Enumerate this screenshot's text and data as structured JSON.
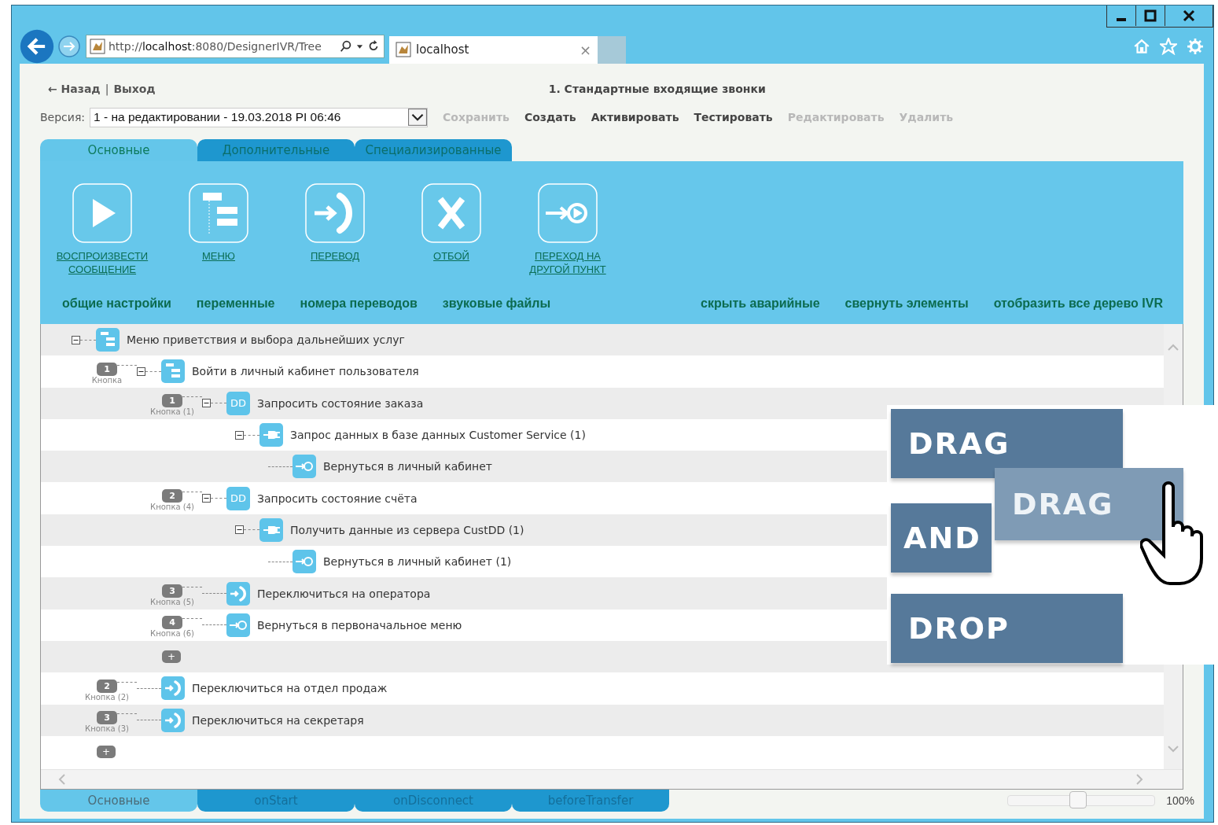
{
  "browser": {
    "url": "http://**localhost**:8080/DesignerIVR/Tree",
    "tab_title": "localhost",
    "tab_close": "×"
  },
  "nav": {
    "back": "← Назад",
    "separator": "|",
    "exit": "Выход"
  },
  "page_title": "1. Стандартные входящие звонки",
  "version": {
    "label": "Версия:",
    "value": "1 - на редактировании - 19.03.2018 PI 06:46"
  },
  "actions": [
    {
      "label": "Сохранить",
      "disabled": true
    },
    {
      "label": "Создать",
      "disabled": false
    },
    {
      "label": "Активировать",
      "disabled": false
    },
    {
      "label": "Тестировать",
      "disabled": false
    },
    {
      "label": "Редактировать",
      "disabled": true
    },
    {
      "label": "Удалить",
      "disabled": true
    }
  ],
  "tabs": [
    {
      "label": "Основные",
      "selected": true
    },
    {
      "label": "Дополнительные",
      "selected": false
    },
    {
      "label": "Специализированные",
      "selected": false
    }
  ],
  "tools": [
    {
      "kind": "play",
      "label": "ВОСПРОИЗВЕСТИ\nСООБЩЕНИЕ"
    },
    {
      "kind": "menu",
      "label": "МЕНЮ"
    },
    {
      "kind": "transfer",
      "label": "ПЕРЕВОД"
    },
    {
      "kind": "hangup",
      "label": "ОТБОЙ"
    },
    {
      "kind": "goto",
      "label": "ПЕРЕХОД НА\nДРУГОЙ ПУНКТ"
    }
  ],
  "links_left": [
    "общие настройки",
    "переменные",
    "номера переводов",
    "звуковые файлы"
  ],
  "links_right": [
    "скрыть аварийные",
    "свернуть элементы",
    "отобразить все дерево IVR"
  ],
  "tree": {
    "kind": "menu",
    "label": "Меню приветствия и выбора дальнейших услуг",
    "expanded": true,
    "children": [
      {
        "badge": "1",
        "caption": "Кнопка",
        "kind": "menu",
        "label": "Войти в личный кабинет пользователя",
        "expanded": true,
        "add": "+",
        "children": [
          {
            "badge": "1",
            "caption": "Кнопка (1)",
            "kind": "dd",
            "icon_text": "DD",
            "label": "Запросить состояние заказа",
            "expanded": true,
            "children": [
              {
                "kind": "plug",
                "label": "Запрос данных в базе данных Customer Service (1)",
                "expanded": true,
                "children": [
                  {
                    "kind": "goto",
                    "label": "Вернуться в личный кабинет"
                  }
                ]
              }
            ]
          },
          {
            "badge": "2",
            "caption": "Кнопка (4)",
            "kind": "dd",
            "icon_text": "DD",
            "label": "Запросить состояние счёта",
            "expanded": true,
            "children": [
              {
                "kind": "plug",
                "label": "Получить данные из сервера CustDD (1)",
                "expanded": true,
                "children": [
                  {
                    "kind": "goto",
                    "label": "Вернуться в личный кабинет (1)"
                  }
                ]
              }
            ]
          },
          {
            "badge": "3",
            "caption": "Кнопка (5)",
            "kind": "transfer",
            "label": "Переключиться на оператора"
          },
          {
            "badge": "4",
            "caption": "Кнопка (6)",
            "kind": "goto",
            "label": "Вернуться в первоначальное меню"
          }
        ]
      },
      {
        "badge": "2",
        "caption": "Кнопка (2)",
        "kind": "transfer",
        "label": "Переключиться на отдел продаж"
      },
      {
        "badge": "3",
        "caption": "Кнопка (3)",
        "kind": "transfer",
        "label": "Переключиться на секретаря"
      }
    ],
    "add": "+"
  },
  "bottom_tabs": [
    {
      "label": "Основные",
      "selected": true
    },
    {
      "label": "onStart",
      "selected": false
    },
    {
      "label": "onDisconnect",
      "selected": false
    },
    {
      "label": "beforeTransfer",
      "selected": false
    }
  ],
  "zoom": {
    "level": 0.48,
    "reading": "100%"
  },
  "overlay": {
    "drag": "DRAG",
    "and": "AND",
    "drop": "DROP",
    "dragged": "DRAG"
  }
}
